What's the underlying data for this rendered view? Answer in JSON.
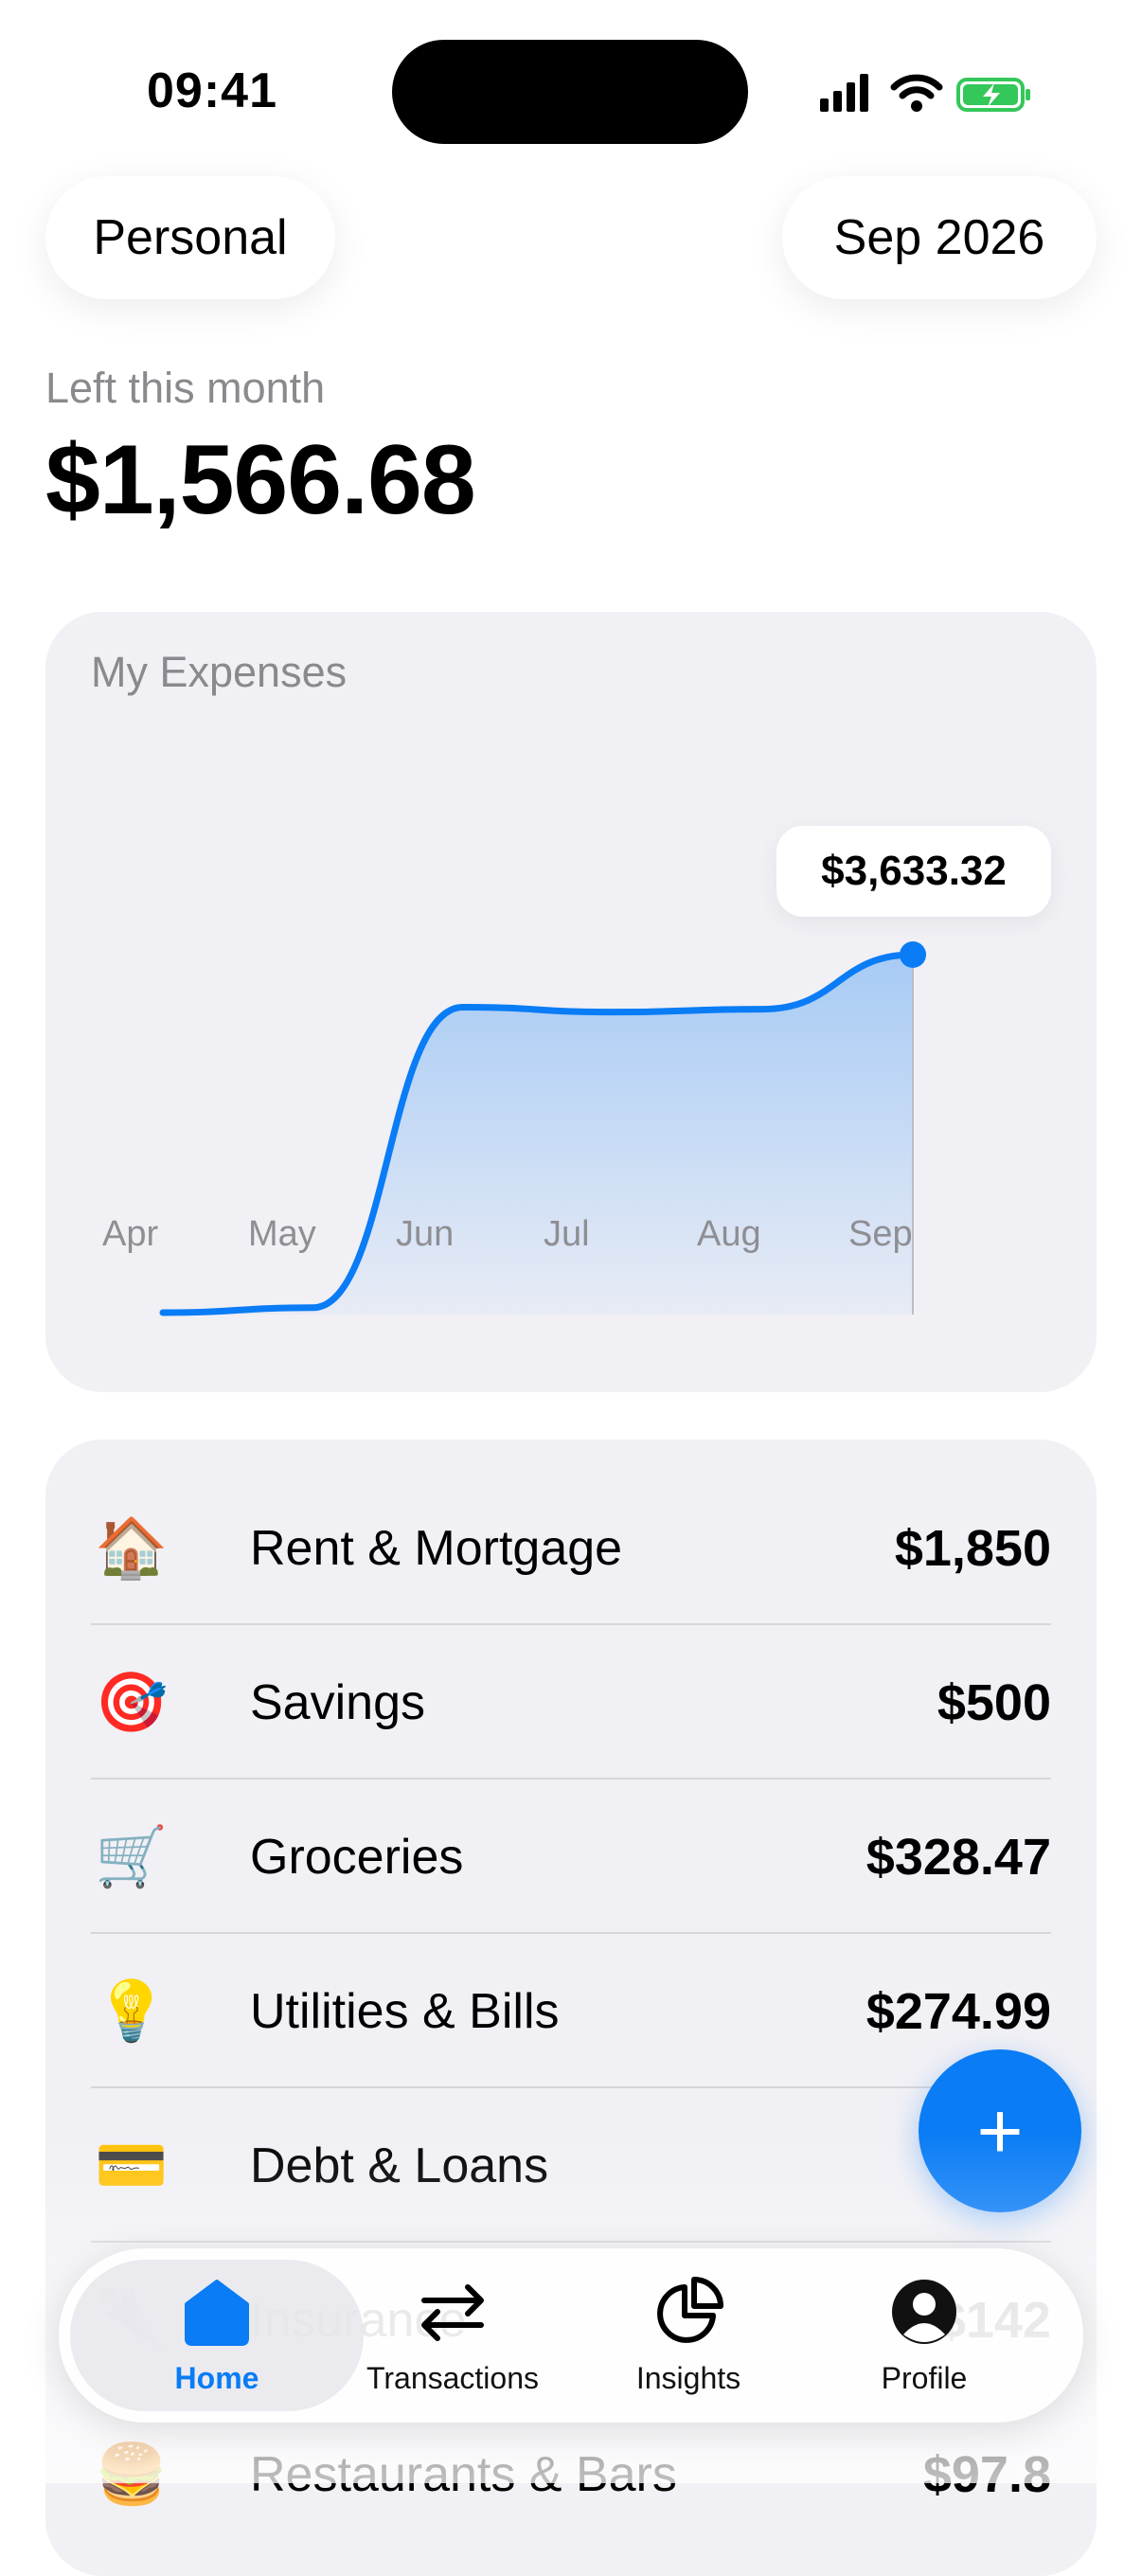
{
  "status_bar": {
    "time": "09:41"
  },
  "header": {
    "account": "Personal",
    "period": "Sep 2026"
  },
  "summary": {
    "label": "Left this month",
    "amount": "$1,566.68"
  },
  "expenses_card": {
    "title": "My Expenses",
    "tooltip": "$3,633.32",
    "accent": "#0a7cf5"
  },
  "chart_data": {
    "type": "area",
    "categories": [
      "Apr",
      "May",
      "Jun",
      "Jul",
      "Aug",
      "Sep"
    ],
    "values": [
      0,
      50,
      3100,
      3050,
      3080,
      3633.32
    ],
    "highlight": {
      "category": "Sep",
      "value": 3633.32
    },
    "grid": false
  },
  "expenses": [
    {
      "icon": "🏠",
      "label": "Rent & Mortgage",
      "amount": "$1,850"
    },
    {
      "icon": "🎯",
      "label": "Savings",
      "amount": "$500"
    },
    {
      "icon": "🛒",
      "label": "Groceries",
      "amount": "$328.47"
    },
    {
      "icon": "💡",
      "label": "Utilities & Bills",
      "amount": "$274.99"
    },
    {
      "icon": "💳",
      "label": "Debt & Loans",
      "amount": "$"
    },
    {
      "icon": "🌂",
      "label": "Insurance",
      "amount": "$142"
    },
    {
      "icon": "🍔",
      "label": "Restaurants & Bars",
      "amount": "$97.8"
    }
  ],
  "fab": {
    "label": "+"
  },
  "tabs": [
    {
      "label": "Home",
      "icon": "home-icon",
      "active": true
    },
    {
      "label": "Transactions",
      "icon": "transfer-arrows-icon",
      "active": false
    },
    {
      "label": "Insights",
      "icon": "pie-chart-icon",
      "active": false
    },
    {
      "label": "Profile",
      "icon": "person-circle-icon",
      "active": false
    }
  ]
}
